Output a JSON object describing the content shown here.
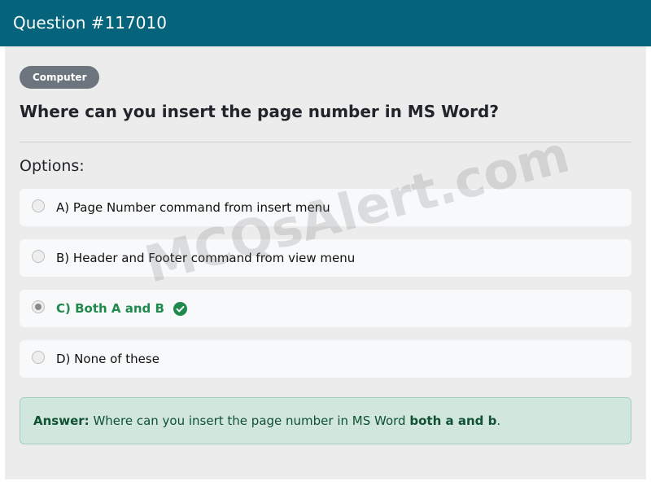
{
  "header": {
    "title": "Question #117010"
  },
  "category_badge": "Computer",
  "question": "Where can you insert the page number in MS Word?",
  "options_title": "Options:",
  "options": [
    {
      "label": "A) Page Number command from insert menu",
      "selected": false,
      "correct": false
    },
    {
      "label": "B) Header and Footer command from view menu",
      "selected": false,
      "correct": false
    },
    {
      "label": "C) Both A and B",
      "selected": true,
      "correct": true
    },
    {
      "label": "D) None of these",
      "selected": false,
      "correct": false
    }
  ],
  "answer": {
    "label": "Answer:",
    "text": "Where can you insert the page number in MS Word",
    "highlight": "both a and b",
    "end": "."
  },
  "watermark": "MCQsAlert.com",
  "colors": {
    "header_bg": "#05647b",
    "correct_green": "#1f8a4c",
    "answer_bg": "#d1e7dd"
  },
  "icons": {
    "correct": "check-circle-icon",
    "radio": "radio-button"
  }
}
